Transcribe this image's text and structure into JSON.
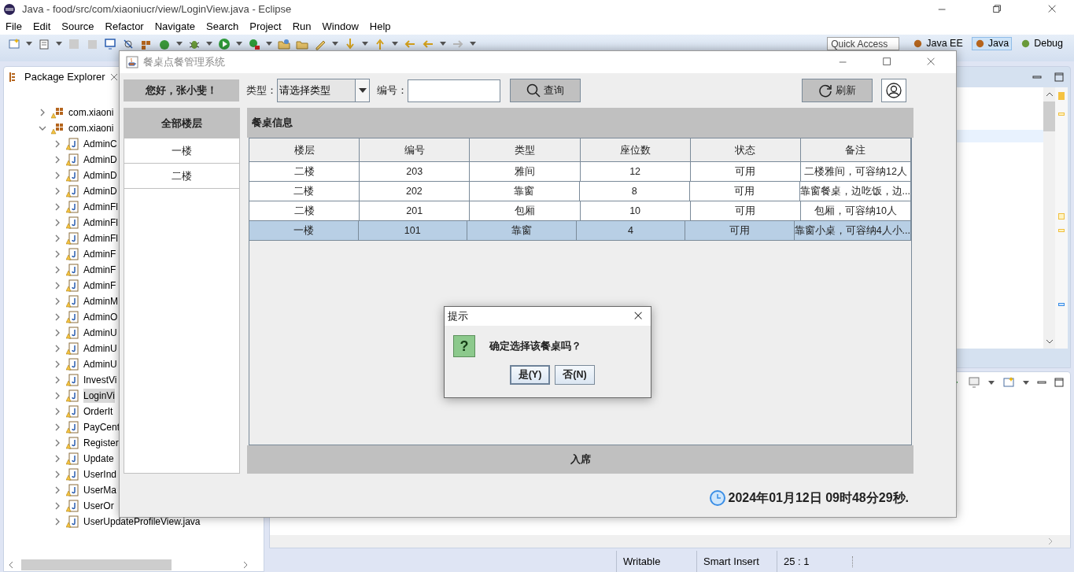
{
  "window": {
    "title": "Java - food/src/com/xiaoniucr/view/LoginView.java - Eclipse"
  },
  "menu": [
    "File",
    "Edit",
    "Source",
    "Refactor",
    "Navigate",
    "Search",
    "Project",
    "Run",
    "Window",
    "Help"
  ],
  "quick_access": {
    "placeholder": "Quick Access"
  },
  "perspectives": [
    {
      "label": "Java EE",
      "selected": false
    },
    {
      "label": "Java",
      "selected": true
    },
    {
      "label": "Debug",
      "selected": false
    }
  ],
  "package_explorer": {
    "title": "Package Explorer",
    "tree": [
      {
        "label": "com.xiaoni",
        "expanded": false
      },
      {
        "label": "com.xiaoni",
        "expanded": true,
        "children": [
          {
            "label": "AdminC",
            "selected": false
          },
          {
            "label": "AdminD",
            "selected": false
          },
          {
            "label": "AdminD",
            "selected": false
          },
          {
            "label": "AdminD",
            "selected": false
          },
          {
            "label": "AdminFl",
            "selected": false
          },
          {
            "label": "AdminFl",
            "selected": false
          },
          {
            "label": "AdminFl",
            "selected": false
          },
          {
            "label": "AdminF",
            "selected": false
          },
          {
            "label": "AdminF",
            "selected": false
          },
          {
            "label": "AdminF",
            "selected": false
          },
          {
            "label": "AdminM",
            "selected": false
          },
          {
            "label": "AdminO",
            "selected": false
          },
          {
            "label": "AdminU",
            "selected": false
          },
          {
            "label": "AdminU",
            "selected": false
          },
          {
            "label": "AdminU",
            "selected": false
          },
          {
            "label": "InvestVi",
            "selected": false
          },
          {
            "label": "LoginVi",
            "selected": true
          },
          {
            "label": "OrderIt",
            "selected": false
          },
          {
            "label": "PayCent",
            "selected": false
          },
          {
            "label": "Register",
            "selected": false
          },
          {
            "label": "Update",
            "selected": false
          },
          {
            "label": "UserInd",
            "selected": false
          },
          {
            "label": "UserMa",
            "selected": false
          },
          {
            "label": "UserOr",
            "selected": false
          },
          {
            "label": "UserUpdateProfileView.java",
            "selected": false
          }
        ]
      }
    ]
  },
  "status_bar": [
    "Writable",
    "Smart Insert",
    "25 : 1"
  ],
  "app": {
    "title": "餐桌点餐管理系统",
    "greeting": "您好，张小斐！",
    "type_label": "类型：",
    "type_select": {
      "value": "请选择类型"
    },
    "number_label": "编号：",
    "search_button": "查询",
    "refresh_button": "刷新",
    "floors": {
      "header": "全部楼层",
      "items": [
        {
          "label": "一楼",
          "selected": false
        },
        {
          "label": "二楼",
          "selected": false
        }
      ]
    },
    "table": {
      "title": "餐桌信息",
      "columns": [
        "楼层",
        "编号",
        "类型",
        "座位数",
        "状态",
        "备注"
      ],
      "rows": [
        {
          "cells": [
            "二楼",
            "203",
            "雅间",
            "12",
            "可用",
            "二楼雅间，可容纳12人"
          ],
          "selected": false
        },
        {
          "cells": [
            "二楼",
            "202",
            "靠窗",
            "8",
            "可用",
            "靠窗餐桌，边吃饭，边..."
          ],
          "selected": false
        },
        {
          "cells": [
            "二楼",
            "201",
            "包厢",
            "10",
            "可用",
            "包厢，可容纳10人"
          ],
          "selected": false
        },
        {
          "cells": [
            "一楼",
            "101",
            "靠窗",
            "4",
            "可用",
            "靠窗小桌，可容纳4人小..."
          ],
          "selected": true
        }
      ]
    },
    "seat_button": "入席",
    "clock": "2024年01月12日 09时48分29秒."
  },
  "dialog": {
    "title": "提示",
    "icon": "?",
    "message": "确定选择该餐桌吗？",
    "buttons": [
      {
        "label": "是(Y)",
        "focused": true
      },
      {
        "label": "否(N)",
        "focused": false
      }
    ]
  }
}
